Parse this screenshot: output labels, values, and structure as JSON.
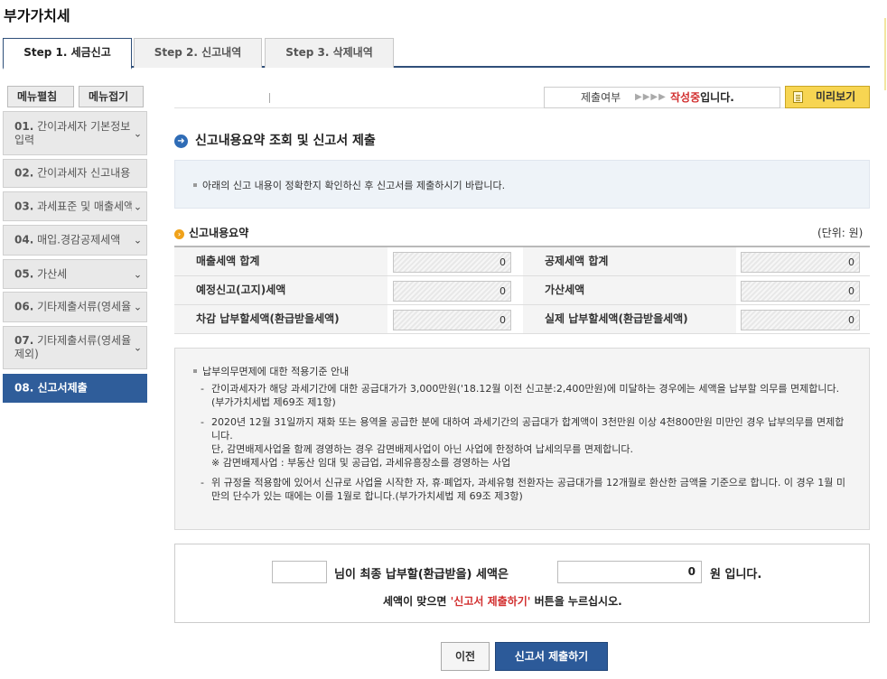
{
  "page": {
    "title": "부가가치세"
  },
  "tabs": [
    {
      "label": "Step 1. 세금신고",
      "active": true
    },
    {
      "label": "Step 2. 신고내역",
      "active": false
    },
    {
      "label": "Step 3. 삭제내역",
      "active": false
    }
  ],
  "sidebar": {
    "expand_label": "메뉴펼침",
    "collapse_label": "메뉴접기",
    "items": [
      {
        "num": "01.",
        "label": "간이과세자 기본정보 입력"
      },
      {
        "num": "02.",
        "label": "간이과세자 신고내용"
      },
      {
        "num": "03.",
        "label": "과세표준 및 매출세액"
      },
      {
        "num": "04.",
        "label": "매입.경감공제세액"
      },
      {
        "num": "05.",
        "label": "가산세"
      },
      {
        "num": "06.",
        "label": "기타제출서류(영세율"
      },
      {
        "num": "07.",
        "label": "기타제출서류(영세율 제외)"
      },
      {
        "num": "08.",
        "label": "신고서제출"
      }
    ],
    "chevron": "⌄"
  },
  "status": {
    "label": "제출여부",
    "arrows": "▶▶▶▶",
    "value_highlight": "작성중",
    "value_suffix": "입니다."
  },
  "preview_button": "미리보기",
  "section": {
    "title": "신고내용요약 조회 및 신고서 제출",
    "notice": "아래의 신고 내용이 정확한지 확인하신 후 신고서를 제출하시기 바랍니다."
  },
  "summary": {
    "title": "신고내용요약",
    "unit": "(단위: 원)",
    "rows": [
      {
        "left_label": "매출세액 합계",
        "left_value": "0",
        "right_label": "공제세액 합계",
        "right_value": "0"
      },
      {
        "left_label": "예정신고(고지)세액",
        "left_value": "0",
        "right_label": "가산세액",
        "right_value": "0"
      },
      {
        "left_label": "차감 납부할세액(환급받을세액)",
        "left_value": "0",
        "right_label": "실제 납부할세액(환급받을세액)",
        "right_value": "0"
      }
    ]
  },
  "rules": {
    "head": "납부의무면제에 대한 적용기준 안내",
    "item1": "간이과세자가 해당 과세기간에 대한 공급대가가 3,000만원('18.12월 이전 신고분:2,400만원)에 미달하는 경우에는 세액을 납부할 의무를 면제합니다.(부가가치세법 제69조 제1항)",
    "item2_line1": "2020년 12월 31일까지 재화 또는 용역을 공급한 분에 대하여 과세기간의 공급대가 합계액이 3천만원 이상 4천800만원 미만인 경우 납부의무를 면제합니다.",
    "item2_line2": "단, 감면배제사업을 함께 경영하는 경우 감면배제사업이 아닌 사업에 한정하여 납세의무를 면제합니다.",
    "item2_line3": "※ 감면배제사업 : 부동산 임대 및 공급업, 과세유흥장소를 경영하는 사업",
    "item3": "위 규정을 적용함에 있어서 신규로 사업을 시작한 자, 휴·폐업자, 과세유형 전환자는 공급대가를 12개월로 환산한 금액을 기준으로 합니다. 이 경우 1월 미만의 단수가 있는 때에는 이를 1월로 합니다.(부가가치세법 제 69조 제3항)"
  },
  "final": {
    "name_value": "",
    "text1": "님이 최종 납부할(환급받을) 세액은",
    "amount": "0",
    "text2": "원 입니다.",
    "hint_prefix": "세액이 맞으면",
    "hint_highlight": "'신고서 제출하기'",
    "hint_suffix": "버튼을 누르십시오."
  },
  "buttons": {
    "prev": "이전",
    "submit": "신고서 제출하기"
  },
  "colors": {
    "accent": "#2c5a99",
    "highlight_red": "#d23030",
    "preview_yellow": "#f7d552"
  }
}
